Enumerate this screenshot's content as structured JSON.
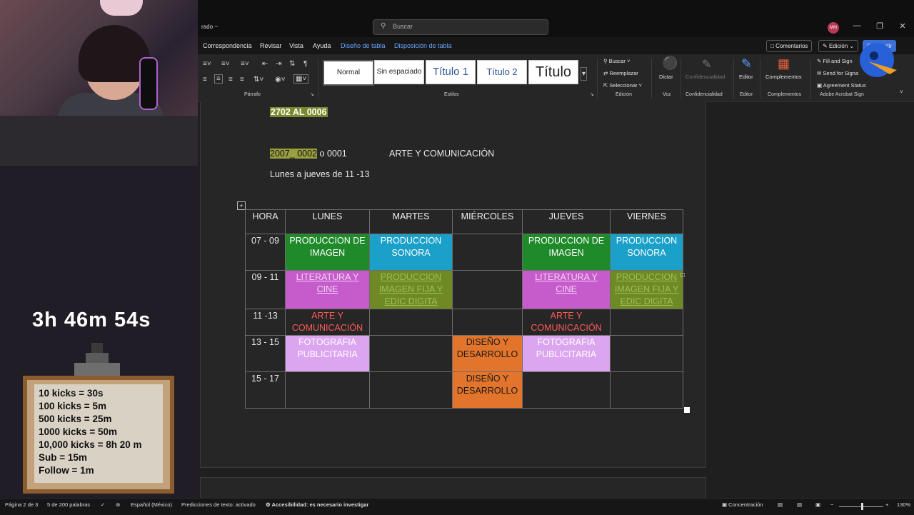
{
  "titlebar": {
    "doc_title": "rado ~",
    "search_placeholder": "Buscar",
    "avatar_initials": "MM"
  },
  "menu": {
    "items": [
      "Correspondencia",
      "Revisar",
      "Vista",
      "Ayuda",
      "Diseño de tabla",
      "Disposición de tabla"
    ],
    "comments": "Comentarios",
    "editing": "Edición",
    "share": "Compartir"
  },
  "ribbon": {
    "groups": {
      "paragraph": "Párrafo",
      "styles": "Estilos",
      "editing": "Edición",
      "voice": "Voz",
      "sensitivity": "Confidencialidad",
      "editor": "Editor",
      "addins": "Complementos",
      "acrobat": "Adobe Acrobat Sign"
    },
    "styles": [
      "Normal",
      "Sin espaciado",
      "Título 1",
      "Título 2",
      "Título"
    ],
    "edit_items": [
      "Buscar",
      "Reemplazar",
      "Seleccionar"
    ],
    "dictate": "Dictar",
    "sensitivity": "Confidencialidad",
    "editor": "Editor",
    "addins": "Complementos",
    "acrobat_items": [
      "Fill and Sign",
      "Send for Signa",
      "Agreement Status"
    ]
  },
  "document": {
    "line1_code": "2702   AL 0006",
    "line2_code": "2007_ 0002",
    "line2_rest": "o 0001",
    "line2_subject": "ARTE Y COMUNICACIÓN",
    "line3": "Lunes a jueves de 11 -13"
  },
  "schedule": {
    "headers": [
      "HORA",
      "LUNES",
      "MARTES",
      "MIÉRCOLES",
      "JUEVES",
      "VIERNES"
    ],
    "rows": [
      {
        "hour": "07 - 09",
        "cells": [
          "PRODUCCION DE IMAGEN",
          "PRODUCCION SONORA",
          "",
          "PRODUCCION DE IMAGEN",
          "PRODUCCION SONORA"
        ]
      },
      {
        "hour": "09 - 11",
        "cells": [
          "LITERATURA Y CINE",
          "PRODUCCION IMAGEN FIJA Y EDIC DIGITA",
          "",
          "LITERATURA Y CINE",
          "PRODUCCION IMAGEN FIJA Y EDIC DIGITA"
        ]
      },
      {
        "hour": "11 -13",
        "cells": [
          "ARTE Y COMUNICACIÓN",
          "",
          "",
          "ARTE Y COMUNICACIÓN",
          ""
        ]
      },
      {
        "hour": "13 - 15",
        "cells": [
          "FOTOGRAFIA PUBLICITARIA",
          "",
          "DISEÑO Y DESARROLLO",
          "FOTOGRAFIA PUBLICITARIA",
          ""
        ]
      },
      {
        "hour": "15 - 17",
        "cells": [
          "",
          "",
          "DISEÑO Y DESARROLLO",
          "",
          ""
        ]
      }
    ]
  },
  "statusbar": {
    "page": "Página 2 de 3",
    "words": "5 de 200 palabras",
    "language": "Español (México)",
    "predictions": "Predicciones de texto: activado",
    "accessibility": "Accesibilidad: es necesario investigar",
    "focus": "Concentración",
    "zoom": "130%"
  },
  "stream": {
    "timer": "3h 46m 54s",
    "kicks": [
      "10 kicks = 30s",
      "100 kicks = 5m",
      "500 kicks = 25m",
      "1000 kicks = 50m",
      "10,000 kicks = 8h 20 m",
      "Sub = 15m",
      "Follow = 1m"
    ]
  },
  "colors": {
    "green": "#1f8a2a",
    "blue": "#1aa0c9",
    "magenta": "#c65bcb",
    "olive": "#6f8a25",
    "lilac": "#dba5f0",
    "orange": "#e2742b",
    "accent": "#6aa6ff"
  }
}
